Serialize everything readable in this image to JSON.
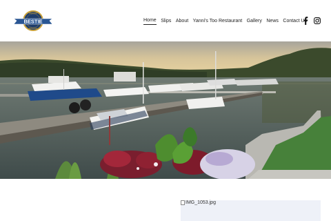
{
  "brand": {
    "logo_text": "BESTIE",
    "colors": {
      "navy": "#1f3d6b",
      "gold": "#c9a13b",
      "ribbon": "#2a5693"
    }
  },
  "nav": {
    "items": [
      {
        "label": "Home",
        "active": true
      },
      {
        "label": "Slips",
        "active": false
      },
      {
        "label": "About",
        "active": false
      },
      {
        "label": "Yanni's Too Restaurant",
        "active": false
      },
      {
        "label": "Gallery",
        "active": false
      },
      {
        "label": "News",
        "active": false
      },
      {
        "label": "Contact Us",
        "active": false
      }
    ]
  },
  "social": {
    "facebook": "facebook-icon",
    "instagram": "instagram-icon"
  },
  "hero": {
    "description_icon": "marina-photo"
  },
  "image_placeholder": {
    "alt_text": "IMG_1053.jpg"
  }
}
